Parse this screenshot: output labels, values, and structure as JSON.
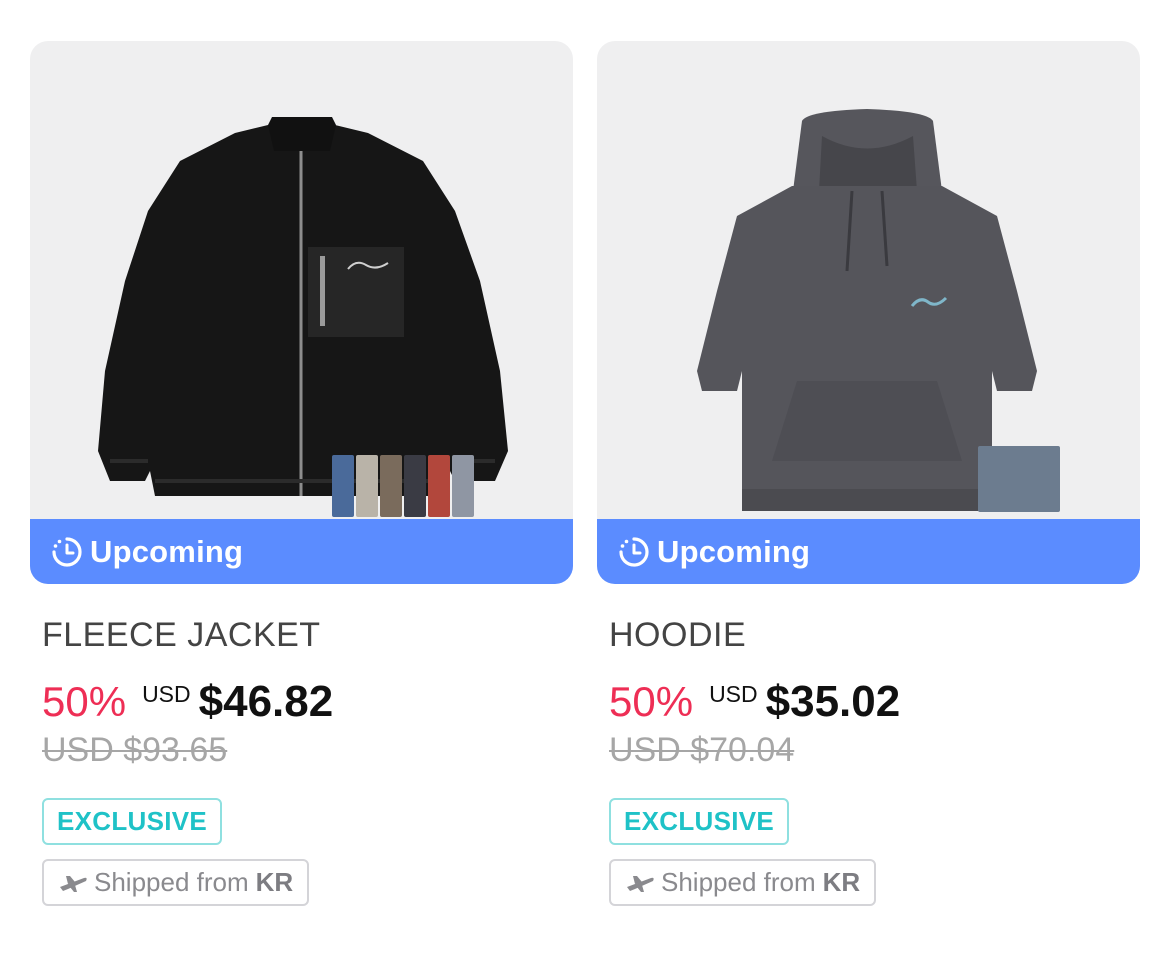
{
  "colors": {
    "status_bar": "#5b8cff",
    "discount": "#ee2e55",
    "exclusive": "#1fc2c7",
    "thumb_bg": "#efeff0"
  },
  "products": [
    {
      "status": "Upcoming",
      "status_icon": "clock-icon",
      "name": "FLEECE JACKET",
      "discount": "50%",
      "currency": "USD",
      "sale_price": "$46.82",
      "original_price": "USD $93.65",
      "badge": "EXCLUSIVE",
      "shipping": {
        "icon": "airplane-icon",
        "label": "Shipped from",
        "country": "KR"
      }
    },
    {
      "status": "Upcoming",
      "status_icon": "clock-icon",
      "name": "HOODIE",
      "discount": "50%",
      "currency": "USD",
      "sale_price": "$35.02",
      "original_price": "USD $70.04",
      "badge": "EXCLUSIVE",
      "shipping": {
        "icon": "airplane-icon",
        "label": "Shipped from",
        "country": "KR"
      }
    }
  ]
}
